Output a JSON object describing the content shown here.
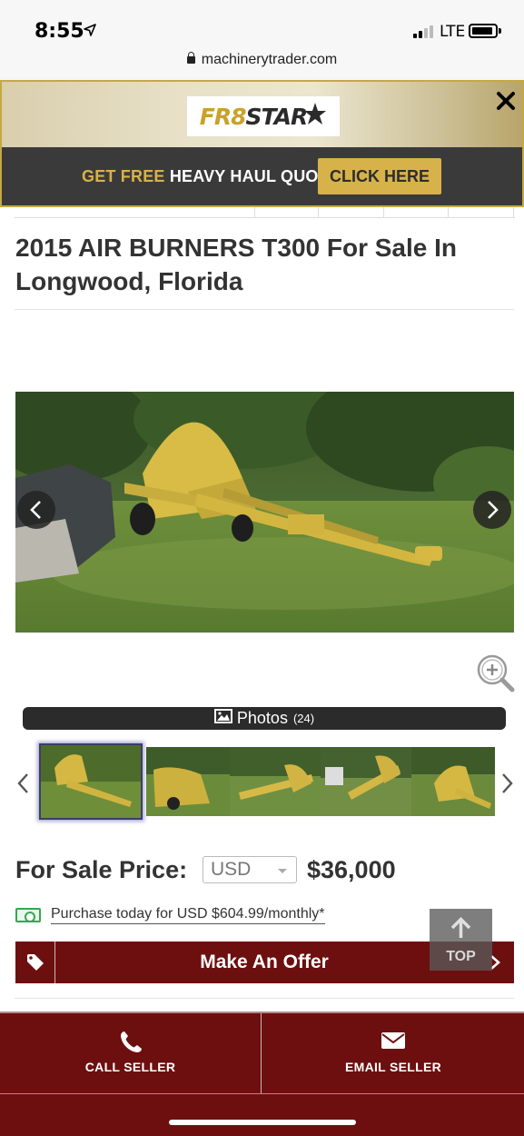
{
  "status_bar": {
    "time": "8:55",
    "network": "LTE",
    "url": "machinerytrader.com"
  },
  "ad": {
    "logo_part1": "FR8",
    "logo_part2": "STAR",
    "promo_highlight": "GET FREE",
    "promo_text": "HEAVY HAUL QUOTES",
    "cta_label": "CLICK HERE",
    "colors": {
      "gold": "#d7b24a",
      "dark": "#3a3a3a"
    }
  },
  "listing": {
    "title": "2015 AIR BURNERS T300 For Sale In Longwood, Florida"
  },
  "gallery": {
    "photos_label": "Photos",
    "photos_count": "(24)",
    "thumbnail_count": 5,
    "active_thumbnail": 1
  },
  "pricing": {
    "label": "For Sale Price:",
    "currency_selected": "USD",
    "price": "$36,000",
    "finance_text": "Purchase today for USD $604.99/monthly*"
  },
  "actions": {
    "offer_label": "Make An Offer",
    "top_label": "TOP",
    "call_label": "CALL SELLER",
    "email_label": "EMAIL SELLER"
  },
  "theme": {
    "brand_maroon": "#6d0f0f",
    "finance_green": "#33a852"
  }
}
